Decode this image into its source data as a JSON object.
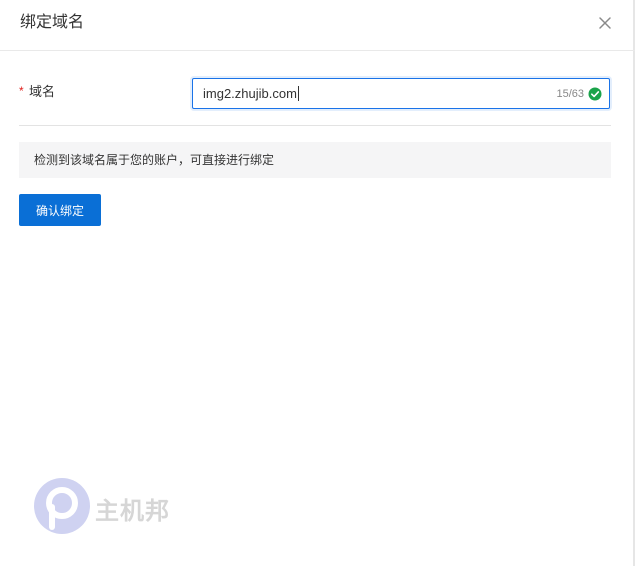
{
  "dialog": {
    "title": "绑定域名",
    "close_icon": "close-icon"
  },
  "form": {
    "required_mark": "*",
    "domain_label": "域名",
    "domain_value": "img2.zhujib.com",
    "char_count": "15/63",
    "valid_icon": "check-circle-icon",
    "valid_color": "#1aa34a"
  },
  "notice": {
    "text": "检测到该域名属于您的账户，可直接进行绑定"
  },
  "actions": {
    "confirm_label": "确认绑定",
    "confirm_color": "#0a6fd6"
  },
  "watermark": {
    "text": "主机邦",
    "logo_icon": "watermark-logo-icon"
  }
}
